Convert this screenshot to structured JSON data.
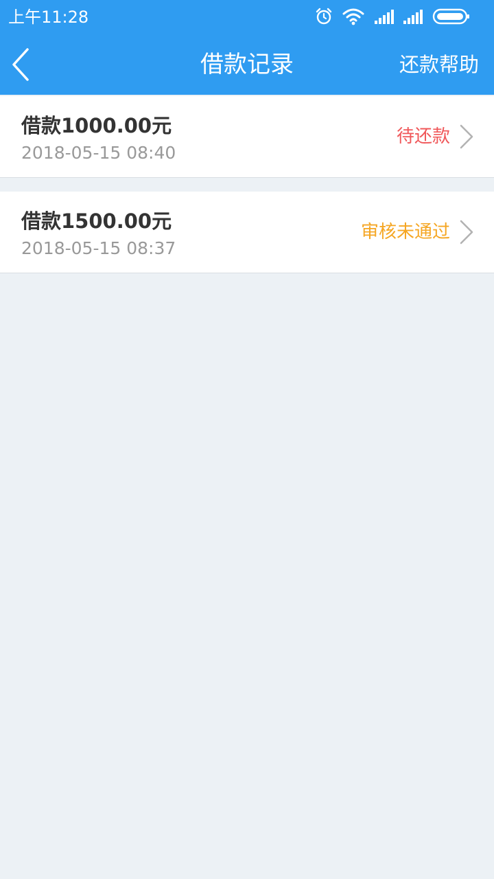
{
  "status_bar": {
    "time": "上午11:28",
    "icons": [
      "alarm-icon",
      "wifi-icon",
      "signal-icon",
      "signal-icon",
      "battery-icon"
    ]
  },
  "nav": {
    "title": "借款记录",
    "right_action": "还款帮助",
    "back_icon": "back-icon"
  },
  "records": [
    {
      "amount": "借款1000.00元",
      "time": "2018-05-15 08:40",
      "status": "待还款",
      "status_color": "#f0585a"
    },
    {
      "amount": "借款1500.00元",
      "time": "2018-05-15 08:37",
      "status": "审核未通过",
      "status_color": "#f5a623"
    }
  ],
  "colors": {
    "brand": "#2f9cf1",
    "background": "#ecf1f5"
  }
}
